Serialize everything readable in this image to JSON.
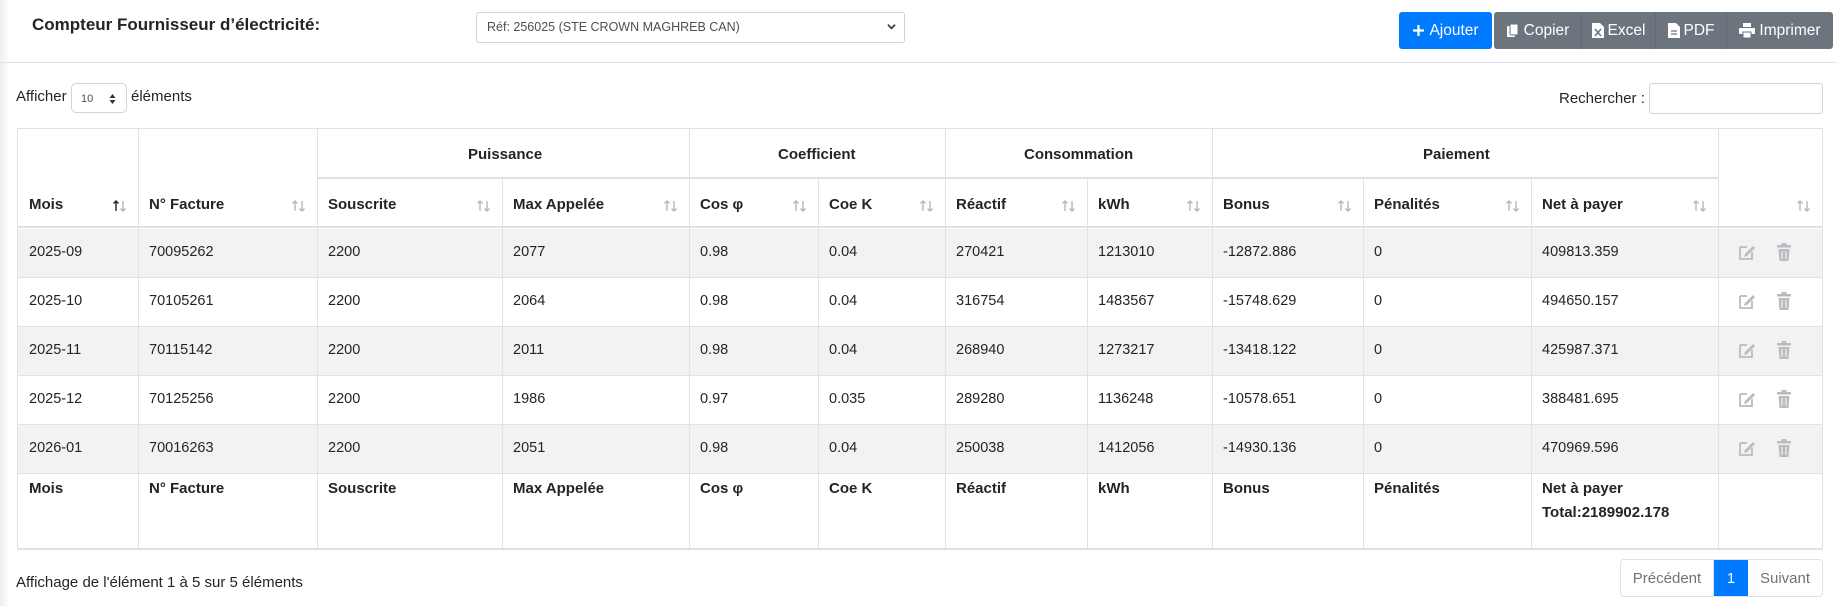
{
  "header": {
    "title": "Compteur Fournisseur d’électricité:",
    "meter_selected": "Réf: 256025 (STE CROWN MAGHREB CAN)"
  },
  "toolbar": {
    "add_label": "Ajouter",
    "copy_label": "Copier",
    "excel_label": "Excel",
    "pdf_label": "PDF",
    "print_label": "Imprimer"
  },
  "length_menu": {
    "prefix": "Afficher",
    "value": "10",
    "suffix": "éléments"
  },
  "search": {
    "label": "Rechercher :",
    "value": ""
  },
  "table": {
    "groups": {
      "puissance": "Puissance",
      "coefficient": "Coefficient",
      "consommation": "Consommation",
      "paiement": "Paiement"
    },
    "columns": [
      "Mois",
      "N° Facture",
      "Souscrite",
      "Max Appelée",
      "Cos φ",
      "Coe K",
      "Réactif",
      "kWh",
      "Bonus",
      "Pénalités",
      "Net à payer"
    ],
    "rows": [
      [
        "2025-09",
        "70095262",
        "2200",
        "2077",
        "0.98",
        "0.04",
        "270421",
        "1213010",
        "-12872.886",
        "0",
        "409813.359"
      ],
      [
        "2025-10",
        "70105261",
        "2200",
        "2064",
        "0.98",
        "0.04",
        "316754",
        "1483567",
        "-15748.629",
        "0",
        "494650.157"
      ],
      [
        "2025-11",
        "70115142",
        "2200",
        "2011",
        "0.98",
        "0.04",
        "268940",
        "1273217",
        "-13418.122",
        "0",
        "425987.371"
      ],
      [
        "2025-12",
        "70125256",
        "2200",
        "1986",
        "0.97",
        "0.035",
        "289280",
        "1136248",
        "-10578.651",
        "0",
        "388481.695"
      ],
      [
        "2026-01",
        "70016263",
        "2200",
        "2051",
        "0.98",
        "0.04",
        "250038",
        "1412056",
        "-14930.136",
        "0",
        "470969.596"
      ]
    ],
    "footer_total": "Total:2189902.178"
  },
  "info_text": "Affichage de l'élément 1 à 5 sur 5 éléments",
  "pagination": {
    "prev": "Précédent",
    "current": "1",
    "next": "Suivant"
  },
  "colors": {
    "primary": "#007bff",
    "secondary": "#6c757d",
    "stripe": "#f2f2f2",
    "border": "#dee2e6"
  }
}
